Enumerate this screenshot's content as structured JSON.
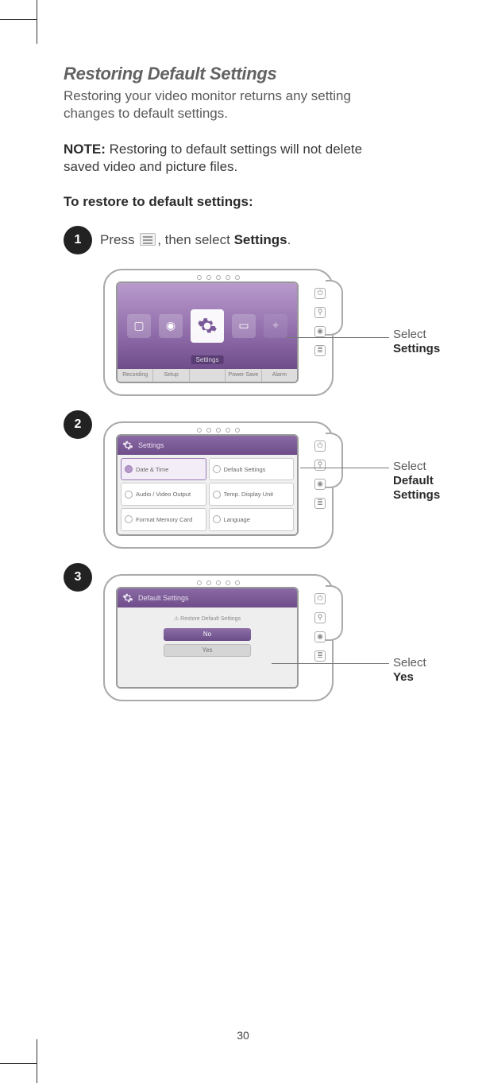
{
  "title": "Restoring Default Settings",
  "intro": "Restoring your video monitor returns any setting changes to default settings.",
  "note_label": "NOTE:",
  "note_text": " Restoring to default settings will not delete saved video and picture files.",
  "instr_head": "To restore to default settings:",
  "step1": {
    "num": "1",
    "pre": "Press ",
    "mid": ", then select ",
    "target": "Settings",
    "after": "."
  },
  "step2_num": "2",
  "step3_num": "3",
  "screen1": {
    "label": "Settings",
    "tabs": [
      "Recording",
      "Setup",
      "",
      "Power Save",
      "Alarm"
    ]
  },
  "screen2": {
    "header": "Settings",
    "items": [
      "Date & Time",
      "Default Settings",
      "Audio / Video Output",
      "Temp. Display Unit",
      "Format Memory Card",
      "Language"
    ]
  },
  "screen3": {
    "header": "Default Settings",
    "prompt": "⚠ Restore Default Settings",
    "no": "No",
    "yes": "Yes"
  },
  "callout1_pre": "Select",
  "callout1_b": " Settings",
  "callout2_pre": "Select",
  "callout2_b1": "Default",
  "callout2_b2": "Settings",
  "callout3_pre": "Select ",
  "callout3_b": "Yes",
  "page_num": "30"
}
